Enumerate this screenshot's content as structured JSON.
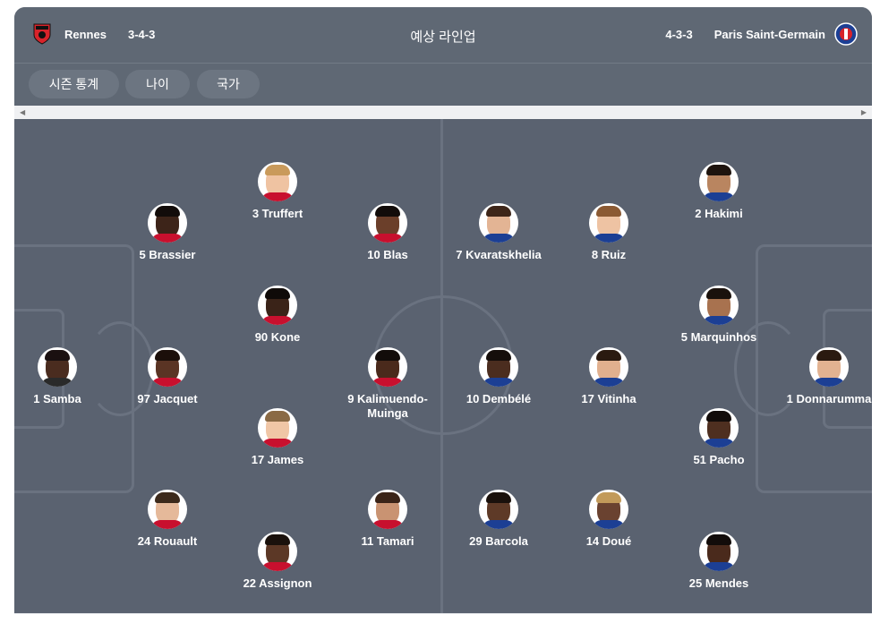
{
  "header": {
    "title": "예상 라인업",
    "home": {
      "name": "Rennes",
      "formation": "3-4-3",
      "crest_color": "#d8232a"
    },
    "away": {
      "name": "Paris Saint-Germain",
      "formation": "4-3-3",
      "crest_color": "#1c3f94"
    }
  },
  "filters": [
    {
      "label": "시즌 통계"
    },
    {
      "label": "나이"
    },
    {
      "label": "국가"
    }
  ],
  "colors": {
    "pitch": "#5a6270",
    "lines": "#6a7280",
    "header": "#5f6874",
    "chip": "#6c7581"
  },
  "players": [
    {
      "label": "1 Samba",
      "skin": "#4a2c1f",
      "hair": "#1a1010",
      "shirt": "#2a2a2a"
    },
    {
      "label": "5 Brassier",
      "skin": "#3d2419",
      "hair": "#120c0a",
      "shirt": "#c8102e"
    },
    {
      "label": "97 Jacquet",
      "skin": "#5a3424",
      "hair": "#1b0f0a",
      "shirt": "#c8102e"
    },
    {
      "label": "24 Rouault",
      "skin": "#e5b99a",
      "hair": "#3c2a1c",
      "shirt": "#c8102e"
    },
    {
      "label": "3 Truffert",
      "skin": "#efc3a2",
      "hair": "#c99a5b",
      "shirt": "#c8102e"
    },
    {
      "label": "90 Kone",
      "skin": "#3a2318",
      "hair": "#0f0a08",
      "shirt": "#c8102e"
    },
    {
      "label": "17 James",
      "skin": "#f0c6a6",
      "hair": "#8a6a45",
      "shirt": "#c8102e"
    },
    {
      "label": "22 Assignon",
      "skin": "#5c3826",
      "hair": "#1a110c",
      "shirt": "#c8102e"
    },
    {
      "label": "10 Blas",
      "skin": "#6b3f2a",
      "hair": "#120c0a",
      "shirt": "#c8102e"
    },
    {
      "label": "9 Kalimuendo-Muinga",
      "skin": "#4a2a1c",
      "hair": "#120c0a",
      "shirt": "#c8102e"
    },
    {
      "label": "11 Tamari",
      "skin": "#c99372",
      "hair": "#3a2418",
      "shirt": "#c8102e"
    },
    {
      "label": "7 Kvaratskhelia",
      "skin": "#e3b494",
      "hair": "#3e2619",
      "shirt": "#1c3f94"
    },
    {
      "label": "10 Dembélé",
      "skin": "#4b2d1f",
      "hair": "#150e0b",
      "shirt": "#1c3f94"
    },
    {
      "label": "29 Barcola",
      "skin": "#5e3a27",
      "hair": "#1a110c",
      "shirt": "#1c3f94"
    },
    {
      "label": "8 Ruiz",
      "skin": "#eec3a3",
      "hair": "#8b5a33",
      "shirt": "#1c3f94"
    },
    {
      "label": "17 Vitinha",
      "skin": "#e1b08e",
      "hair": "#2a1a10",
      "shirt": "#1c3f94"
    },
    {
      "label": "14 Doué",
      "skin": "#6a4230",
      "hair": "#c29a5a",
      "shirt": "#1c3f94"
    },
    {
      "label": "2 Hakimi",
      "skin": "#b98560",
      "hair": "#1e140e",
      "shirt": "#1c3f94"
    },
    {
      "label": "5 Marquinhos",
      "skin": "#a8724f",
      "hair": "#1a110c",
      "shirt": "#1c3f94"
    },
    {
      "label": "51 Pacho",
      "skin": "#4e2f20",
      "hair": "#120c0a",
      "shirt": "#1c3f94"
    },
    {
      "label": "25 Mendes",
      "skin": "#4a2a1c",
      "hair": "#120c0a",
      "shirt": "#1c3f94"
    },
    {
      "label": "1 Donnarumma",
      "skin": "#e2b291",
      "hair": "#2a1a10",
      "shirt": "#1c3f94"
    }
  ]
}
